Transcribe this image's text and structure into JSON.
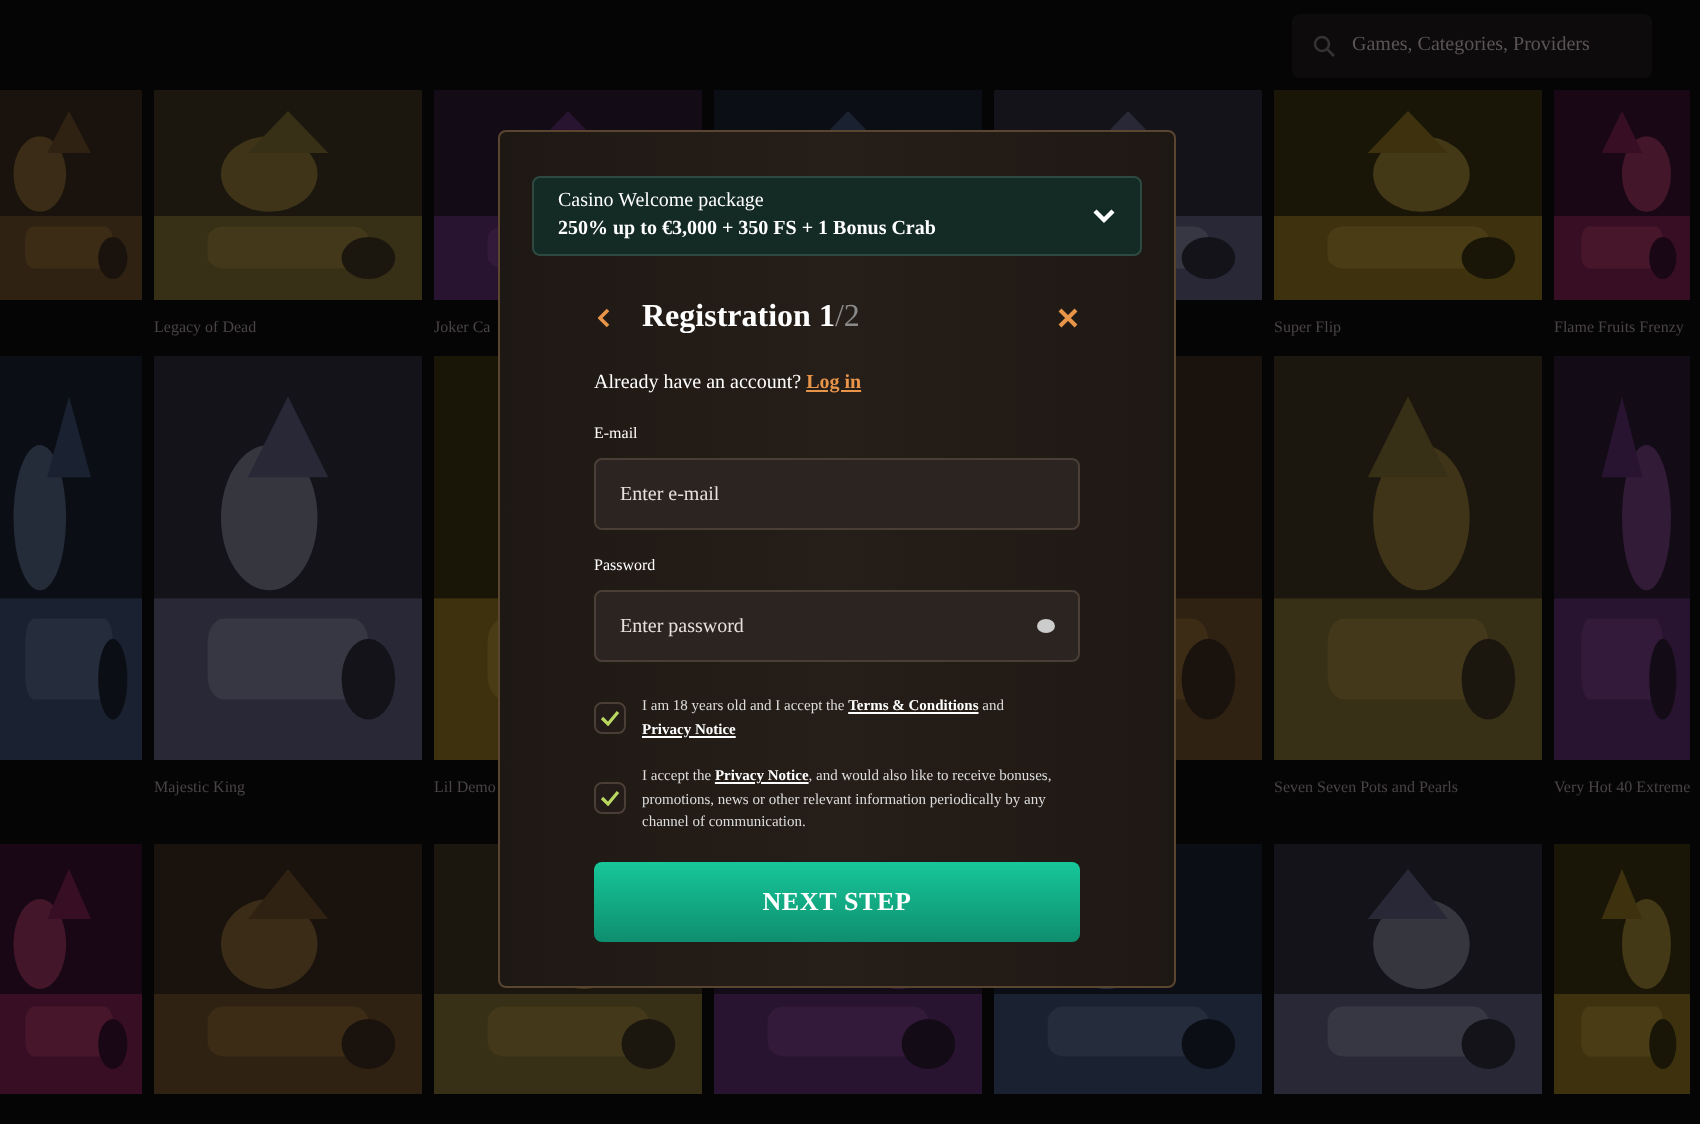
{
  "search": {
    "placeholder": "Games, Categories, Providers"
  },
  "game_rows": [
    {
      "tiles": [
        {
          "kind": "picture"
        },
        {
          "kind": "picture",
          "title": "Legacy of Dead"
        },
        {
          "kind": "picture",
          "title": "Joker Ca"
        },
        {
          "kind": "picture"
        },
        {
          "kind": "picture"
        },
        {
          "kind": "picture",
          "title": "Super Flip"
        },
        {
          "kind": "picture",
          "title": "Flame Fruits Frenzy"
        }
      ]
    },
    {
      "left": [
        {
          "kind": "picture"
        },
        {
          "kind": "picture",
          "title": "Majestic King"
        },
        {
          "kind": "picture",
          "title": "Lil Demo"
        }
      ],
      "right": [
        {
          "kind": "picture"
        },
        {
          "kind": "picture",
          "title": "Seven Seven Pots and Pearls"
        },
        {
          "kind": "picture",
          "title": "Very Hot 40 Extreme"
        }
      ]
    },
    {
      "tiles": [
        {
          "kind": "picture"
        },
        {
          "kind": "picture"
        },
        {
          "kind": "picture"
        },
        {
          "kind": "picture"
        },
        {
          "kind": "picture"
        },
        {
          "kind": "picture"
        },
        {
          "kind": "picture"
        }
      ]
    }
  ],
  "modal": {
    "promo": {
      "label": "Casino Welcome package",
      "text": "250% up to €3,000 + 350 FS + 1 Bonus Crab",
      "expanded": false
    },
    "title": "Registration",
    "step_current": "1",
    "step_total": "/2",
    "login_prompt": "Already have an account?",
    "login_link": "Log in",
    "fields": [
      {
        "label": "E-mail",
        "placeholder": "Enter e-mail",
        "kind": "email"
      },
      {
        "label": "Password",
        "placeholder": "Enter password",
        "kind": "password"
      }
    ],
    "consents": [
      {
        "checked": true,
        "parts": [
          {
            "text": "I am 18 years old and I accept the "
          },
          {
            "text": "Terms & Conditions",
            "kind": "link"
          },
          {
            "text": " and "
          },
          {
            "text": "Privacy Notice",
            "kind": "link"
          }
        ]
      },
      {
        "checked": true,
        "parts": [
          {
            "text": "I accept the "
          },
          {
            "text": "Privacy Notice",
            "kind": "link"
          },
          {
            "text": ", and would also like to receive bonuses, promotions, news or other relevant information periodically by any channel of communication."
          }
        ]
      }
    ],
    "submit": "NEXT STEP"
  }
}
